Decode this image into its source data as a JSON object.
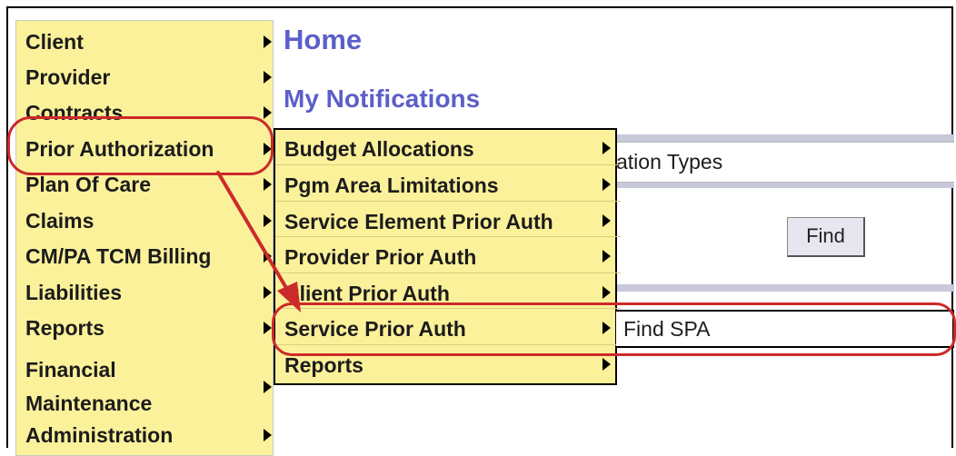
{
  "page": {
    "title": "Home",
    "subtitle": "My Notifications"
  },
  "main_menu": {
    "items": [
      {
        "label": "Client"
      },
      {
        "label": "Provider"
      },
      {
        "label": "Contracts"
      },
      {
        "label": "Prior Authorization"
      },
      {
        "label": "Plan Of Care"
      },
      {
        "label": "Claims"
      },
      {
        "label": "CM/PA TCM Billing"
      },
      {
        "label": "Liabilities"
      },
      {
        "label": "Reports"
      },
      {
        "label": "Financial Maintenance"
      },
      {
        "label": "Administration"
      }
    ]
  },
  "submenu": {
    "items": [
      {
        "label": "Budget Allocations"
      },
      {
        "label": "Pgm Area Limitations"
      },
      {
        "label": "Service Element Prior Auth"
      },
      {
        "label": "Provider Prior Auth"
      },
      {
        "label": "Client Prior Auth"
      },
      {
        "label": "Service Prior Auth"
      },
      {
        "label": "Reports"
      }
    ]
  },
  "flyout": {
    "item": "Find SPA"
  },
  "background": {
    "field_text": "ation Types",
    "find_button": "Find"
  },
  "colors": {
    "menu_bg": "#fbf19a",
    "title": "#5b5fc7",
    "highlight": "#cc2a2a"
  }
}
